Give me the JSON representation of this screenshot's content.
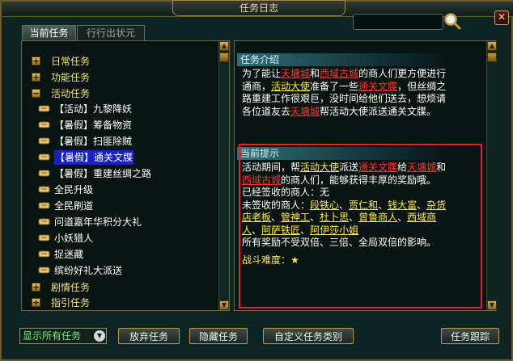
{
  "window": {
    "title": "任务日志"
  },
  "tabs": [
    {
      "label": "当前任务",
      "active": true
    },
    {
      "label": "行行出状元",
      "active": false
    }
  ],
  "tree": {
    "categories": [
      {
        "label": "日常任务",
        "expanded": false
      },
      {
        "label": "功能任务",
        "expanded": false
      },
      {
        "label": "活动任务",
        "expanded": true
      },
      {
        "label": "剧情任务",
        "expanded": false
      },
      {
        "label": "指引任务",
        "expanded": false
      }
    ],
    "tasks": [
      {
        "label": "【活动】九黎降妖",
        "selected": false
      },
      {
        "label": "【暑假】筹备物资",
        "selected": false
      },
      {
        "label": "【暑假】扫匪除贼",
        "selected": false
      },
      {
        "label": "【暑假】通关文牒",
        "selected": true
      },
      {
        "label": "【暑假】重建丝绸之路",
        "selected": false
      },
      {
        "label": "全民升级",
        "selected": false
      },
      {
        "label": "全民刷道",
        "selected": false
      },
      {
        "label": "问道嘉年华积分大礼",
        "selected": false
      },
      {
        "label": "小妖猎人",
        "selected": false
      },
      {
        "label": "捉迷藏",
        "selected": false
      },
      {
        "label": "缤纷好礼大派送",
        "selected": false
      }
    ]
  },
  "intro": {
    "title": "任务介绍",
    "segments": [
      {
        "t": "为了能让",
        "c": ""
      },
      {
        "t": "天墉城",
        "c": "red"
      },
      {
        "t": "和",
        "c": ""
      },
      {
        "t": "西域古城",
        "c": "red"
      },
      {
        "t": "的商人们更方便进行通商，",
        "c": ""
      },
      {
        "t": "活动大使",
        "c": "yel"
      },
      {
        "t": "准备了一些",
        "c": ""
      },
      {
        "t": "通关文牒",
        "c": "red"
      },
      {
        "t": "，但丝绸之路重建工作很艰巨，没时间给他们送去，想烦请各位道友去",
        "c": ""
      },
      {
        "t": "天墉城",
        "c": "red"
      },
      {
        "t": "帮活动大使派送通关文牒。",
        "c": ""
      }
    ]
  },
  "hint": {
    "title": "当前提示",
    "segments": [
      {
        "t": "活动期间，帮",
        "c": ""
      },
      {
        "t": "活动大使",
        "c": "yel"
      },
      {
        "t": "派送",
        "c": ""
      },
      {
        "t": "通关文牒",
        "c": "red"
      },
      {
        "t": "给",
        "c": ""
      },
      {
        "t": "天墉城",
        "c": "red"
      },
      {
        "t": "和",
        "c": ""
      },
      {
        "t": "西域古城",
        "c": "red"
      },
      {
        "t": "的商人们，能够获得丰厚的奖励哦。",
        "c": ""
      }
    ],
    "signed_label": "已经签收的商人：",
    "signed_value": "无",
    "unsigned_label": "未签收的商人：",
    "merchants": [
      "段铁心",
      "贾仁和",
      "钱大富",
      "杂货店老板",
      "管神工",
      "杜卜思",
      "曾鲁商人",
      "西域商人",
      "阿萨铁匠",
      "阿伊莎小姐"
    ],
    "note": "所有奖励不受双倍、三倍、全局双倍的影响。",
    "difficulty_label": "战斗难度：",
    "difficulty_stars": "★"
  },
  "bottom": {
    "filter": "显示所有任务",
    "abandon": "放弃任务",
    "hide": "隐藏任务",
    "custom": "自定义任务类别",
    "track": "任务跟踪"
  },
  "colors": {
    "highlight_red": "#ff3030",
    "link_yellow": "#ffe94a",
    "category_gold": "#f4e27a",
    "selection_blue": "#1621c8"
  }
}
